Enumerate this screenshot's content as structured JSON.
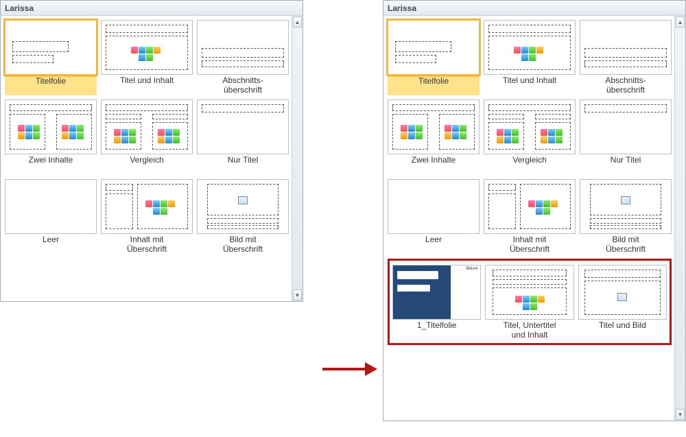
{
  "left": {
    "title": "Larissa",
    "layouts": [
      {
        "label": "Titelfolie"
      },
      {
        "label": "Titel und Inhalt"
      },
      {
        "label": "Abschnitts-\nüberschrift"
      },
      {
        "label": "Zwei Inhalte"
      },
      {
        "label": "Vergleich"
      },
      {
        "label": "Nur Titel"
      },
      {
        "label": "Leer"
      },
      {
        "label": "Inhalt mit\nÜberschrift"
      },
      {
        "label": "Bild mit\nÜberschrift"
      }
    ]
  },
  "right": {
    "title": "Larissa",
    "layouts": [
      {
        "label": "Titelfolie"
      },
      {
        "label": "Titel und Inhalt"
      },
      {
        "label": "Abschnitts-\nüberschrift"
      },
      {
        "label": "Zwei Inhalte"
      },
      {
        "label": "Vergleich"
      },
      {
        "label": "Nur Titel"
      },
      {
        "label": "Leer"
      },
      {
        "label": "Inhalt mit\nÜberschrift"
      },
      {
        "label": "Bild mit\nÜberschrift"
      }
    ],
    "custom": [
      {
        "label": "1_Titelfolie",
        "tag": "Beluni"
      },
      {
        "label": "Titel, Untertitel\nund Inhalt"
      },
      {
        "label": "Titel und Bild"
      }
    ]
  }
}
